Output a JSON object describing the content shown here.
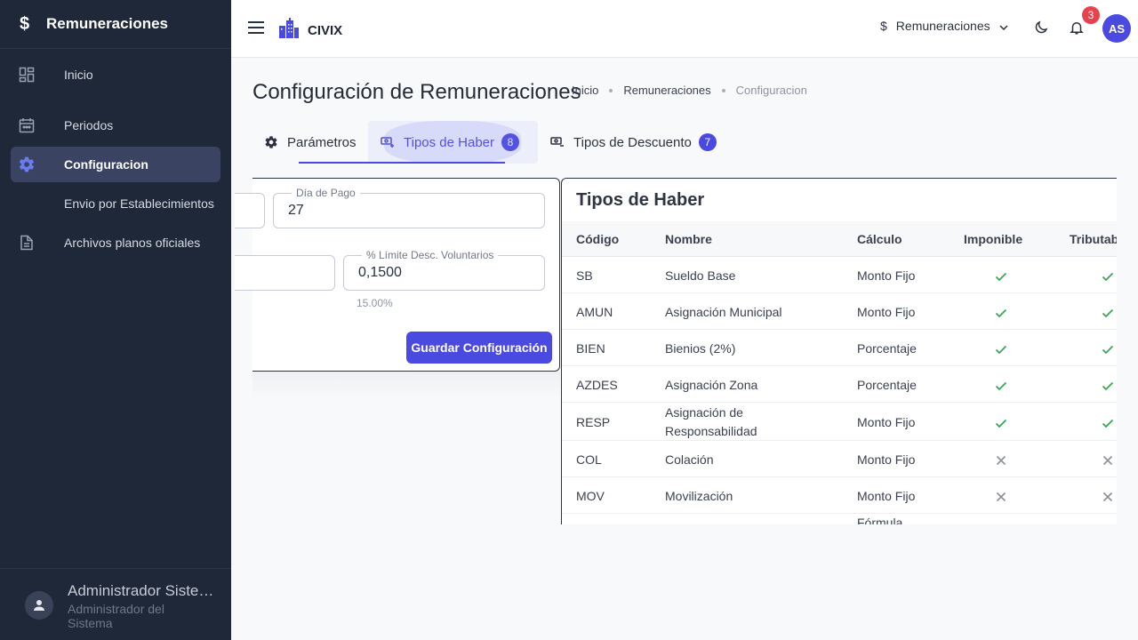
{
  "sidebar": {
    "brand": "Remuneraciones",
    "items": [
      {
        "label": "Inicio"
      },
      {
        "label": "Periodos"
      },
      {
        "label": "Configuracion"
      },
      {
        "label": "Envio por Establecimientos"
      },
      {
        "label": "Archivos planos oficiales"
      }
    ],
    "user": {
      "name": "Administrador Sistema",
      "role": "Administrador del Sistema"
    }
  },
  "header": {
    "brand": "CIVIX",
    "module": "Remuneraciones",
    "notifications": "3",
    "avatar_initials": "AS"
  },
  "page": {
    "title": "Configuración de Remuneraciones",
    "breadcrumb": [
      "Inicio",
      "Remuneraciones",
      "Configuracion"
    ]
  },
  "tabs": [
    {
      "label": "Parámetros"
    },
    {
      "label": "Tipos de Haber",
      "count": "8"
    },
    {
      "label": "Tipos de Descuento",
      "count": "7"
    }
  ],
  "config": {
    "dia_pago_label": "Día de Pago",
    "dia_pago_value": "27",
    "limite_label": "% Límite Desc. Voluntarios",
    "limite_value": "0,1500",
    "limite_hint": "15.00%",
    "save_label": "Guardar Configuración"
  },
  "table": {
    "title": "Tipos de Haber",
    "headers": [
      "Código",
      "Nombre",
      "Cálculo",
      "Imponible",
      "Tributable"
    ],
    "rows": [
      {
        "codigo": "SB",
        "nombre": "Sueldo Base",
        "calculo": "Monto Fijo",
        "imponible": true,
        "tributable": true
      },
      {
        "codigo": "AMUN",
        "nombre": "Asignación Municipal",
        "calculo": "Monto Fijo",
        "imponible": true,
        "tributable": true
      },
      {
        "codigo": "BIEN",
        "nombre": "Bienios (2%)",
        "calculo": "Porcentaje",
        "imponible": true,
        "tributable": true
      },
      {
        "codigo": "AZDES",
        "nombre": "Asignación Zona",
        "calculo": "Porcentaje",
        "imponible": true,
        "tributable": true
      },
      {
        "codigo": "RESP",
        "nombre": "Asignación de Responsabilidad",
        "calculo": "Monto Fijo",
        "imponible": true,
        "tributable": true
      },
      {
        "codigo": "COL",
        "nombre": "Colación",
        "calculo": "Monto Fijo",
        "imponible": false,
        "tributable": false
      },
      {
        "codigo": "MOV",
        "nombre": "Movilización",
        "calculo": "Monto Fijo",
        "imponible": false,
        "tributable": false
      },
      {
        "codigo": "",
        "nombre": "",
        "calculo": "Fórmula",
        "imponible": null,
        "tributable": null
      }
    ]
  },
  "colors": {
    "accent": "#4b4ae0",
    "sidebar_bg": "#1f2838",
    "check": "#3aa655",
    "cross": "#8a909c",
    "badge": "#e8424d"
  }
}
